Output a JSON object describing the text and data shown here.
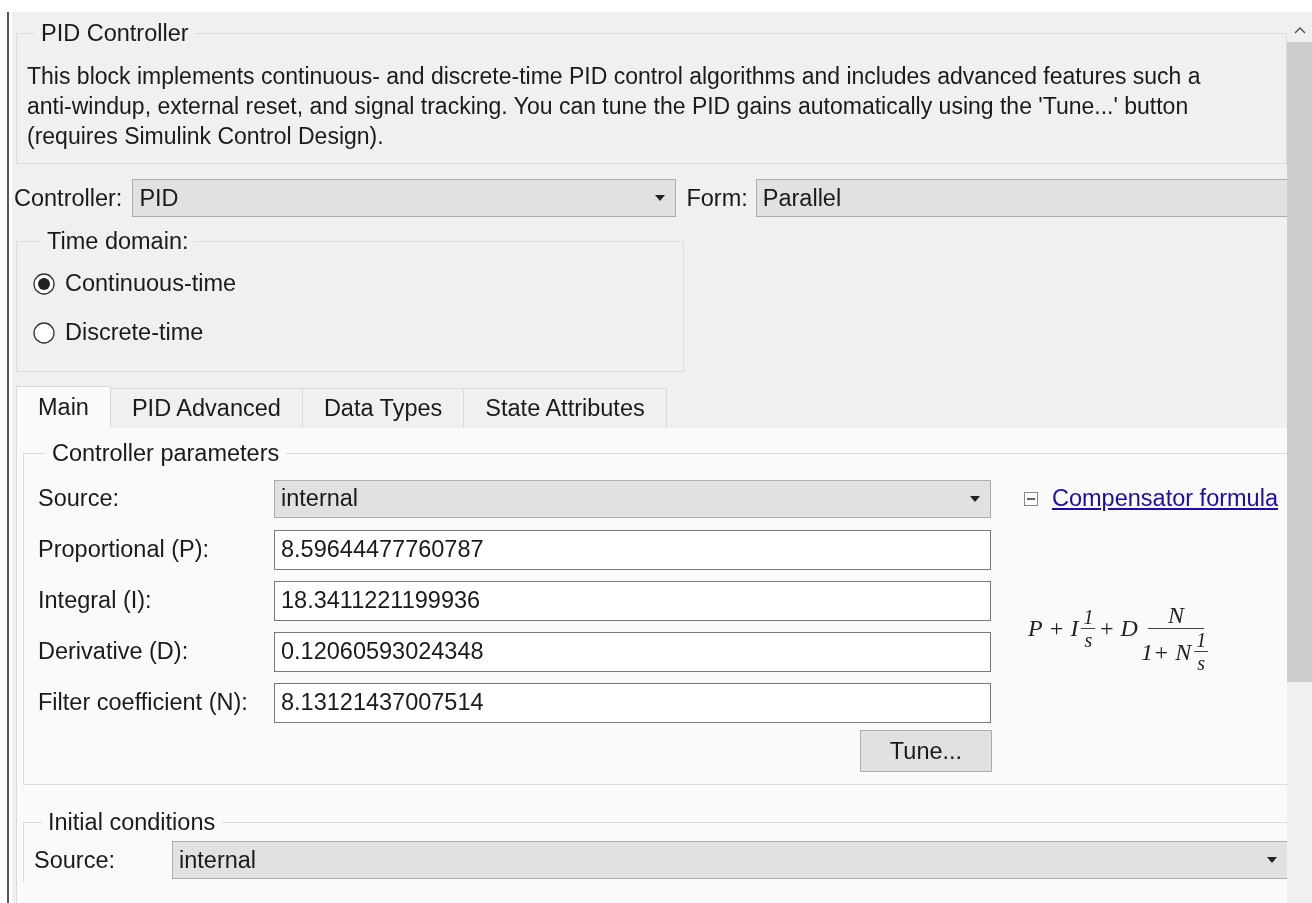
{
  "header": {
    "title": "PID Controller",
    "description_lines": [
      "This block implements continuous- and discrete-time PID control algorithms and includes advanced features such a",
      "anti-windup, external reset, and signal tracking. You can tune the PID gains automatically using the 'Tune...' button",
      "(requires Simulink Control Design)."
    ]
  },
  "controller": {
    "label": "Controller:",
    "value": "PID"
  },
  "form": {
    "label": "Form:",
    "value": "Parallel"
  },
  "time_domain": {
    "title": "Time domain:",
    "options": [
      {
        "label": "Continuous-time",
        "selected": true
      },
      {
        "label": "Discrete-time",
        "selected": false
      }
    ]
  },
  "tabs": [
    {
      "label": "Main",
      "selected": true
    },
    {
      "label": "PID Advanced",
      "selected": false
    },
    {
      "label": "Data Types",
      "selected": false
    },
    {
      "label": "State Attributes",
      "selected": false
    }
  ],
  "controller_parameters": {
    "title": "Controller parameters",
    "source": {
      "label": "Source:",
      "value": "internal"
    },
    "fields": [
      {
        "label": "Proportional (P):",
        "value": "8.59644477760787"
      },
      {
        "label": "Integral (I):",
        "value": "18.3411221199936"
      },
      {
        "label": "Derivative (D):",
        "value": "0.12060593024348"
      },
      {
        "label": "Filter coefficient (N):",
        "value": "8.13121437007514"
      }
    ],
    "tune_button": "Tune...",
    "formula_section": {
      "expanded": true,
      "link": "Compensator formula"
    },
    "formula": {
      "lead": "P + I",
      "frac1_num": "1",
      "frac1_den": "s",
      "mid": "+ D",
      "frac2_num": "N",
      "frac2_den_lead": "1+ N",
      "frac3_num": "1",
      "frac3_den": "s"
    }
  },
  "initial_conditions": {
    "title": "Initial conditions",
    "source": {
      "label": "Source:",
      "value": "internal"
    }
  }
}
